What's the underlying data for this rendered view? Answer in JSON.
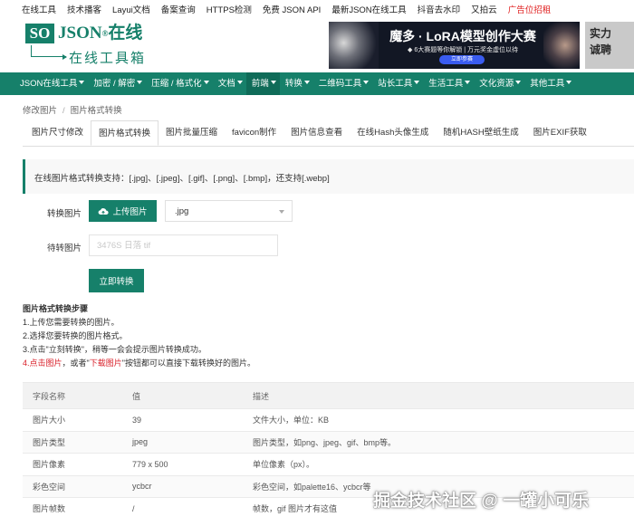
{
  "top_links": [
    {
      "label": "在线工具",
      "ad": false
    },
    {
      "label": "技术播客",
      "ad": false
    },
    {
      "label": "Layui文档",
      "ad": false
    },
    {
      "label": "备案查询",
      "ad": false
    },
    {
      "label": "HTTPS检测",
      "ad": false
    },
    {
      "label": "免费 JSON API",
      "ad": false
    },
    {
      "label": "最新JSON在线工具",
      "ad": false
    },
    {
      "label": "抖音去水印",
      "ad": false
    },
    {
      "label": "又拍云",
      "ad": false
    },
    {
      "label": "广告位招租",
      "ad": true
    }
  ],
  "logo": {
    "box": "SO",
    "word": "JSON",
    "reg": "®",
    "cn": "在线",
    "sub": "在线工具箱"
  },
  "banner": {
    "title": "魔多 · LoRA模型创作大赛",
    "line": "◆ 6大赛题等你解锁 | 万元奖金虚位以待",
    "button": "立即参赛"
  },
  "banner2": {
    "line1": "实力",
    "line2": "诚聘"
  },
  "nav": [
    {
      "label": "JSON在线工具",
      "caret": true,
      "active": false
    },
    {
      "label": "加密 / 解密",
      "caret": true,
      "active": false
    },
    {
      "label": "压缩 / 格式化",
      "caret": true,
      "active": false
    },
    {
      "label": "文档",
      "caret": true,
      "active": false
    },
    {
      "label": "前端",
      "caret": true,
      "active": true
    },
    {
      "label": "转换",
      "caret": true,
      "active": false
    },
    {
      "label": "二维码工具",
      "caret": true,
      "active": false
    },
    {
      "label": "站长工具",
      "caret": true,
      "active": false
    },
    {
      "label": "生活工具",
      "caret": true,
      "active": false
    },
    {
      "label": "文化资源",
      "caret": true,
      "active": false
    },
    {
      "label": "其他工具",
      "caret": true,
      "active": false
    }
  ],
  "breadcrumb": {
    "first": "修改图片",
    "sep": "/",
    "second": "图片格式转换"
  },
  "tabs": [
    {
      "label": "图片尺寸修改",
      "active": false
    },
    {
      "label": "图片格式转换",
      "active": true
    },
    {
      "label": "图片批量压缩",
      "active": false
    },
    {
      "label": "favicon制作",
      "active": false
    },
    {
      "label": "图片信息查看",
      "active": false
    },
    {
      "label": "在线Hash头像生成",
      "active": false
    },
    {
      "label": "随机HASH壁纸生成",
      "active": false
    },
    {
      "label": "图片EXIF获取",
      "active": false
    }
  ],
  "notice": "在线图片格式转换支持：[.jpg]、[.jpeg]、[.gif]、[.png]、[.bmp]，还支持[.webp]",
  "form": {
    "convert_label": "转换图片",
    "upload_label": "上传图片",
    "format_value": ".jpg",
    "pending_label": "待转图片",
    "pending_placeholder": "3476S 日落 tif",
    "convert_button": "立即转换"
  },
  "steps": {
    "title": "图片格式转换步骤",
    "s1": "1.上传您需要转换的图片。",
    "s2": "2.选择您要转换的图片格式。",
    "s3": "3.点击\"立刻转换\"，稍等一会会提示图片转换成功。",
    "s4_prefix": "4.",
    "s4_link1": "点击图片",
    "s4_mid": "，或者\"",
    "s4_link2": "下载图片",
    "s4_suffix": "\"按钮都可以直接下载转换好的图片。"
  },
  "table": {
    "headers": [
      "字段名称",
      "值",
      "描述"
    ],
    "rows": [
      [
        "图片大小",
        "39",
        "文件大小，单位：KB"
      ],
      [
        "图片类型",
        "jpeg",
        "图片类型，如png、jpeg、gif、bmp等。"
      ],
      [
        "图片像素",
        "779 x 500",
        "单位像素（px）。"
      ],
      [
        "彩色空间",
        "ycbcr",
        "彩色空间，如palette16、ycbcr等"
      ],
      [
        "图片帧数",
        "/",
        "帧数，gif 图片才有这值"
      ]
    ]
  },
  "watermark": "掘金技术社区 @ 一罐小可乐",
  "colors": {
    "brand": "#16806a",
    "nav_active": "#0f6b58",
    "ad": "#e02020",
    "step_link": "#d9202a"
  },
  "icons": {
    "upload": "cloud-upload-icon",
    "caret": "caret-down-icon"
  }
}
